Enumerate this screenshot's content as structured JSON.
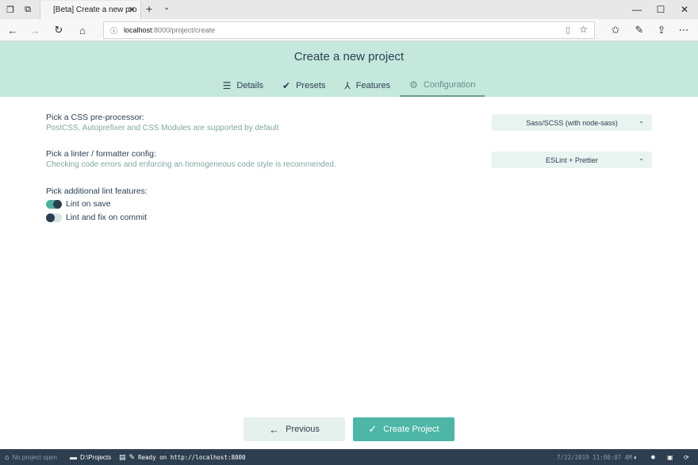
{
  "browser": {
    "tab_title": "[Beta] Create a new pro",
    "new_tab_icon": "plus-icon",
    "url_host": "localhost",
    "url_path": ":8000/project/create"
  },
  "header": {
    "title": "Create a new project",
    "steps": [
      {
        "label": "Details",
        "icon": "list-icon"
      },
      {
        "label": "Presets",
        "icon": "check-circle-icon"
      },
      {
        "label": "Features",
        "icon": "fork-icon"
      },
      {
        "label": "Configuration",
        "icon": "gear-icon"
      }
    ],
    "active_step": "Configuration"
  },
  "config": {
    "css": {
      "title": "Pick a CSS pre-processor:",
      "description": "PostCSS, Autoprefixer and CSS Modules are supported by default",
      "selected": "Sass/SCSS (with node-sass)"
    },
    "linter": {
      "title": "Pick a linter / formatter config:",
      "description": "Checking code errors and enforcing an homogeneous code style is recommended.",
      "selected": "ESLint + Prettier"
    },
    "lint_features": {
      "title": "Pick additional lint features:",
      "options": [
        {
          "label": "Lint on save",
          "checked": true
        },
        {
          "label": "Lint and fix on commit",
          "checked": false
        }
      ]
    }
  },
  "footer": {
    "previous_label": "Previous",
    "create_label": "Create Project"
  },
  "statusbar": {
    "project": "No project open",
    "folder": "D:\\Projects",
    "log": "Ready on http://localhost:8000",
    "datetime": "7/22/2019 11:00:07 AM"
  },
  "colors": {
    "header_bg": "#c5e8dd",
    "accent": "#4db6a6",
    "text": "#2c3e50",
    "muted_text": "#7ea8a3",
    "statusbar_bg": "#2c3e50"
  }
}
